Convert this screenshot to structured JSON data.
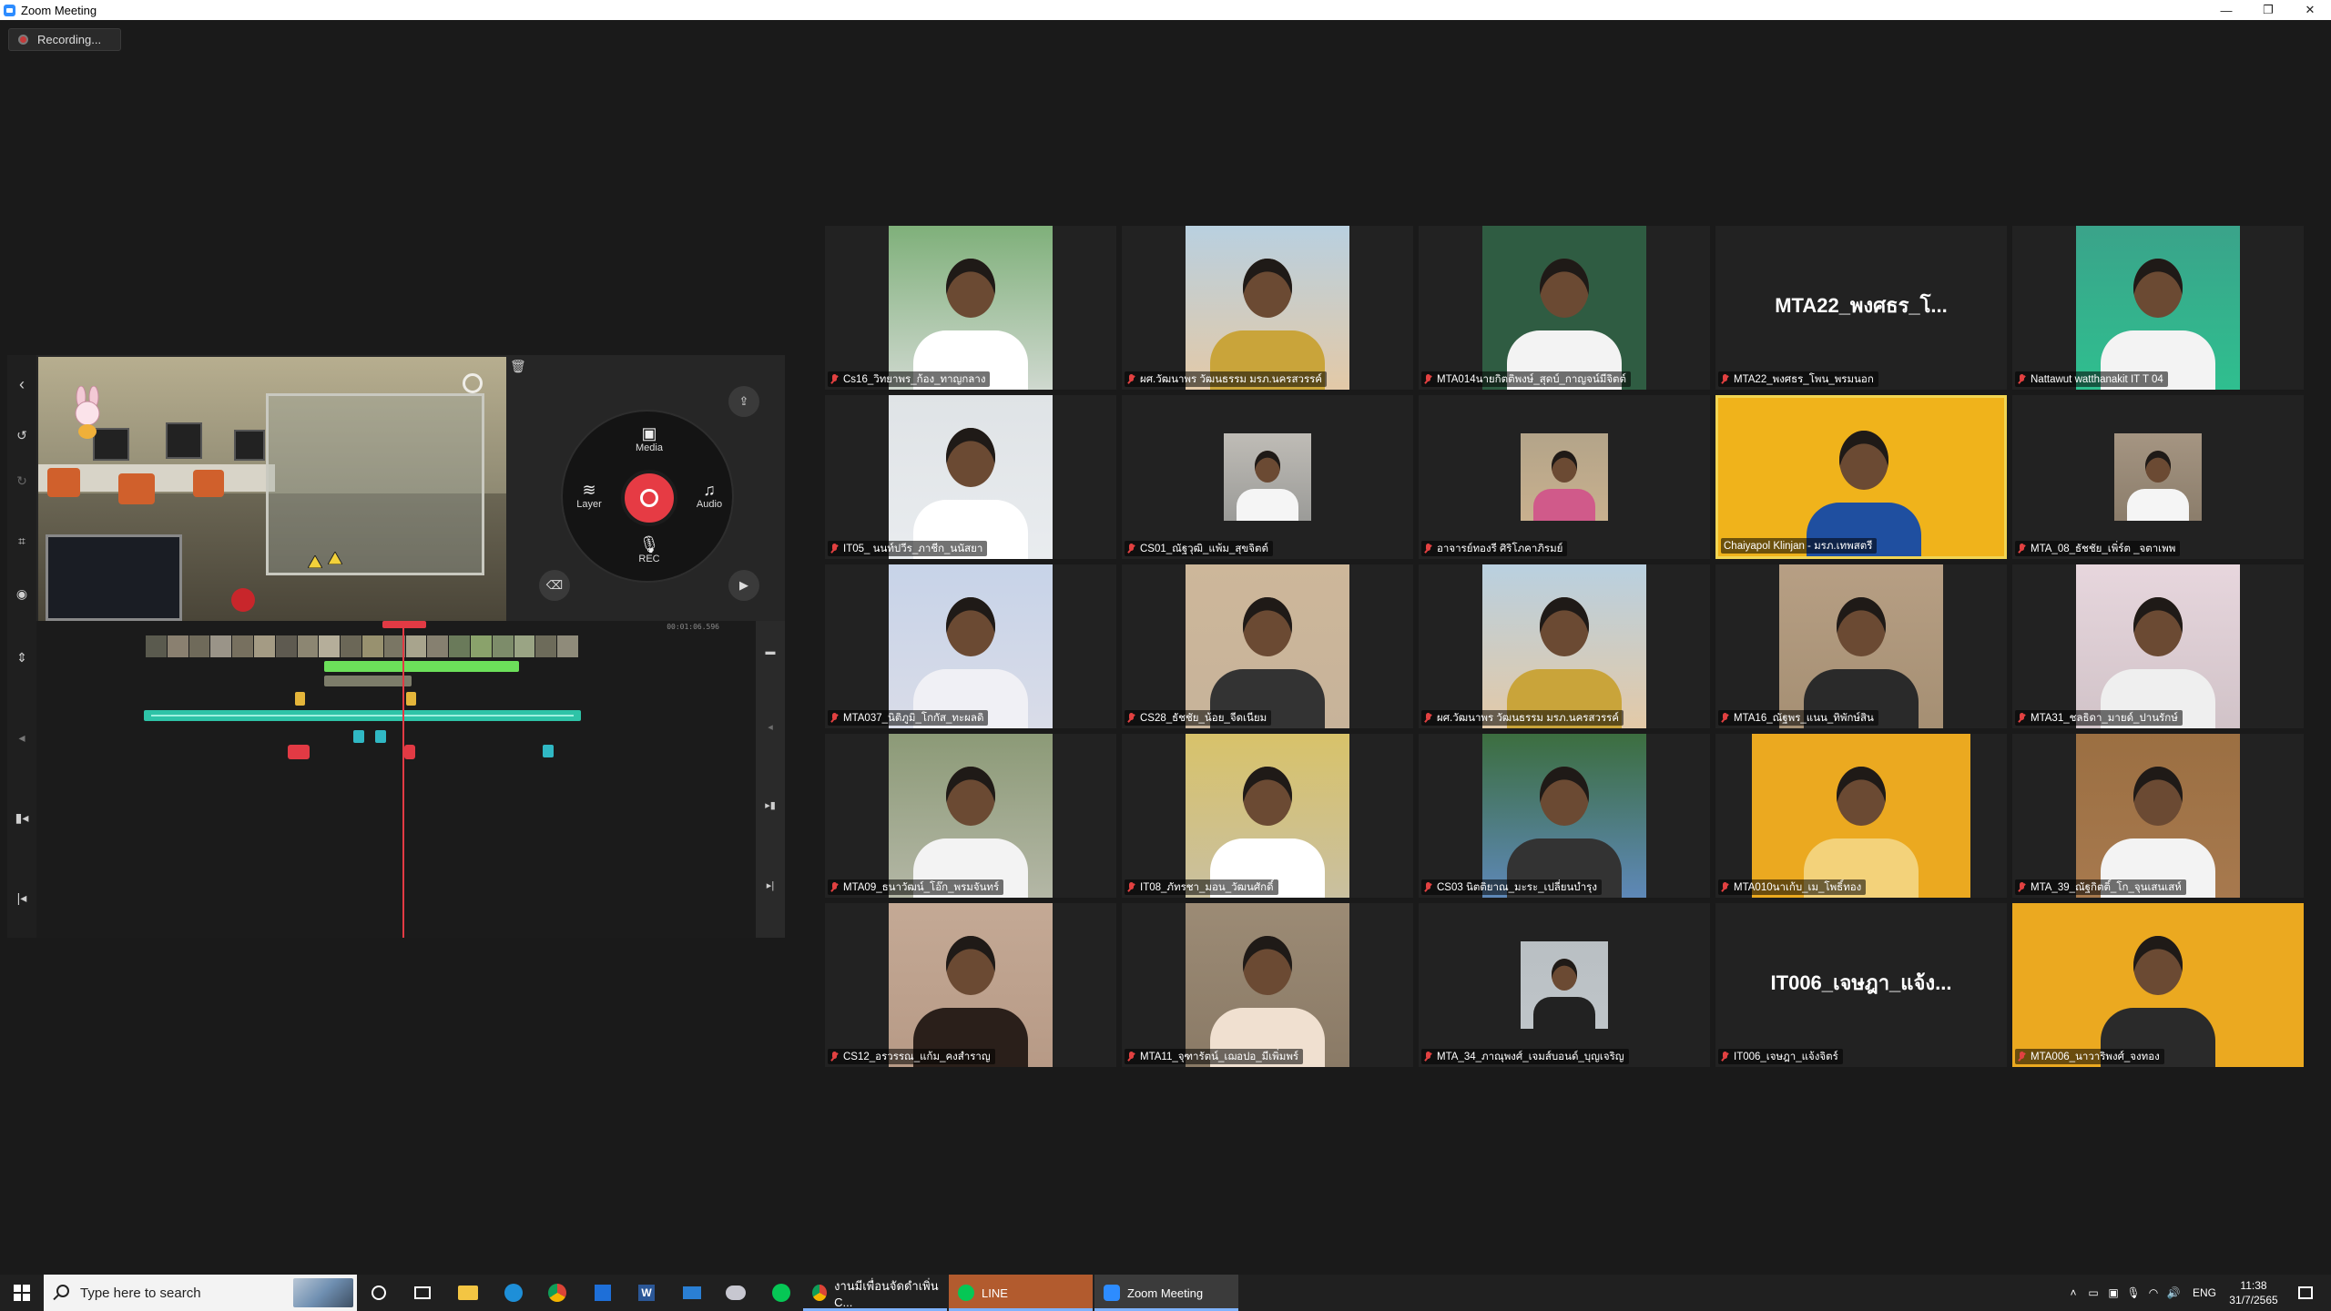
{
  "window": {
    "title": "Zoom Meeting",
    "minimize": "—",
    "maximize": "❐",
    "close": "✕"
  },
  "recording": {
    "label": "Recording..."
  },
  "share": {
    "wheel": {
      "media": "Media",
      "layer": "Layer",
      "audio": "Audio",
      "rec": "REC"
    },
    "timeline_duration": "00:01:06.596"
  },
  "participants": [
    {
      "name": "Cs16_วิทยาพร_ก้อง_ทาญกลาง",
      "tone": "#cfd8cf",
      "shirt": "#ffffff",
      "bg": "#7fb07a"
    },
    {
      "name": "ผศ.วัฒนาพร วัฒนธรรม มรภ.นครสวรรค์",
      "tone": "#e3c9a7",
      "shirt": "#c9a43a",
      "bg": "#b9d0e0"
    },
    {
      "name": "MTA014นายกิตติพงษ์_สุดบ์_กาญจน์มีจิตต์",
      "tone": "#2f5c42",
      "shirt": "#f3f3f3",
      "bg": "#2f5c42"
    },
    {
      "name": "MTA22_พงศธร_โพน_พรมนอก",
      "bigname": "MTA22_พงศธร_โ..."
    },
    {
      "name": "Nattawut watthanakit IT T 04",
      "tone": "#2fbf8f",
      "shirt": "#f3f3f3",
      "bg": "#3aa38a"
    },
    {
      "name": "IT05_ นนท์ปวีร_ภาชีก_นนัสยา",
      "tone": "#e9ecef",
      "shirt": "#ffffff",
      "bg": "#dfe3e6"
    },
    {
      "name": "CS01_ณัฐวุฒิ_แพ้ม_สุขจิตต์",
      "tone": "#9b9b98",
      "shirt": "#f5f5f5",
      "bg": "#bfbcb6"
    },
    {
      "name": "อาจารย์ทองรี ศิริโภคาภิรมย์",
      "tone": "#c9b08e",
      "shirt": "#d05a8a",
      "bg": "#b3a489"
    },
    {
      "name": "Chaiyapol Klinjan - มรภ.เทพสตรี",
      "tone": "#f0b31b",
      "shirt": "#1f4fa0",
      "bg": "#f0b31b",
      "active": true
    },
    {
      "name": "MTA_08_ธัชชัย_เพิ่ร์ต _จตาเพพ",
      "tone": "#8b7d6b",
      "shirt": "#f5f5f5",
      "bg": "#a59582"
    },
    {
      "name": "MTA037_นิติภูมิ_โกกัส_ทะผลดิ",
      "tone": "#d9dce8",
      "shirt": "#f0f0f5",
      "bg": "#c7d3e8"
    },
    {
      "name": "CS28_ธัชชัย_น้อย_จีดเนียม",
      "tone": "#c7b39a",
      "shirt": "#333333",
      "bg": "#cdb79a"
    },
    {
      "name": "ผศ.วัฒนาพร วัฒนธรรม มรภ.นครสวรรค์",
      "tone": "#e3c9a7",
      "shirt": "#c9a43a",
      "bg": "#b9d0e0"
    },
    {
      "name": "MTA16_ณัฐพร_แนน_ทิพักษ์สิน",
      "tone": "#a58f73",
      "shirt": "#2a2a2a",
      "bg": "#b79f84"
    },
    {
      "name": "MTA31_ชลธิดา_มายด์_ปานรักษ์",
      "tone": "#d1c3c8",
      "shirt": "#efefef",
      "bg": "#e7d6dd"
    },
    {
      "name": "MTA09_ธนาวัฒน์_โอ๊ก_พรมจันทร์",
      "tone": "#b4b7a6",
      "shirt": "#f3f3f3",
      "bg": "#8c9a77"
    },
    {
      "name": "IT08_ภัทรชา_มอน_วัฒนศักดิ์",
      "tone": "#c9c0a0",
      "shirt": "#ffffff",
      "bg": "#d8c26a"
    },
    {
      "name": "CS03 นิตติยาณ_มะระ_เปลี่ยนบำรุง",
      "tone": "#5e88b8",
      "shirt": "#333333",
      "bg": "#3c6e3f"
    },
    {
      "name": "MTA010นาเก้บ_เม_โพธิ์ทอง",
      "tone": "#eba920",
      "shirt": "#f3d27a",
      "bg": "#eba920"
    },
    {
      "name": "MTA_39_ณัฐกิตติ์_โก_จุนเสนเสห์",
      "tone": "#a7794e",
      "shirt": "#f3f3f3",
      "bg": "#9b6f42"
    },
    {
      "name": "CS12_อรวรรณ_แก้ม_คงสำราญ",
      "tone": "#b79a86",
      "shirt": "#2a1f1a",
      "bg": "#c4a995"
    },
    {
      "name": "MTA11_จุฑารัตน์_เฌอปอ_มีเพิ่มพร์",
      "tone": "#8a7a66",
      "shirt": "#f0e0d0",
      "bg": "#9c8b75"
    },
    {
      "name": "MTA_34_ภาณุพงศ์_เจมส์บอนด์_บุญเจริญ",
      "tone": "#bfc5c9",
      "shirt": "#222222",
      "bg": "#b9bfc3"
    },
    {
      "name": "IT006_เจษฎา_แจ้งจิตร์",
      "bigname": "IT006_เจษฎา_แจ้ง..."
    },
    {
      "name": "MTA006_นาวาริพงศ์_จงทอง",
      "tone": "#eba920",
      "shirt": "#2a2a2a",
      "bg": "#eba920"
    }
  ],
  "taskbar": {
    "search_placeholder": "Type here to search",
    "apps": [
      {
        "label": "งานมีเพื่อนจัดดำเพิ่น C...",
        "icon": "chrome-icon"
      },
      {
        "label": "LINE",
        "icon": "line-icon"
      },
      {
        "label": "Zoom Meeting",
        "icon": "zoom-icon"
      }
    ],
    "language": "ENG",
    "time": "11:38",
    "date": "31/7/2565"
  },
  "colors": {
    "active_speaker": "#f1d553",
    "mic_muted": "#e24141",
    "rec_button": "#e63b44"
  }
}
